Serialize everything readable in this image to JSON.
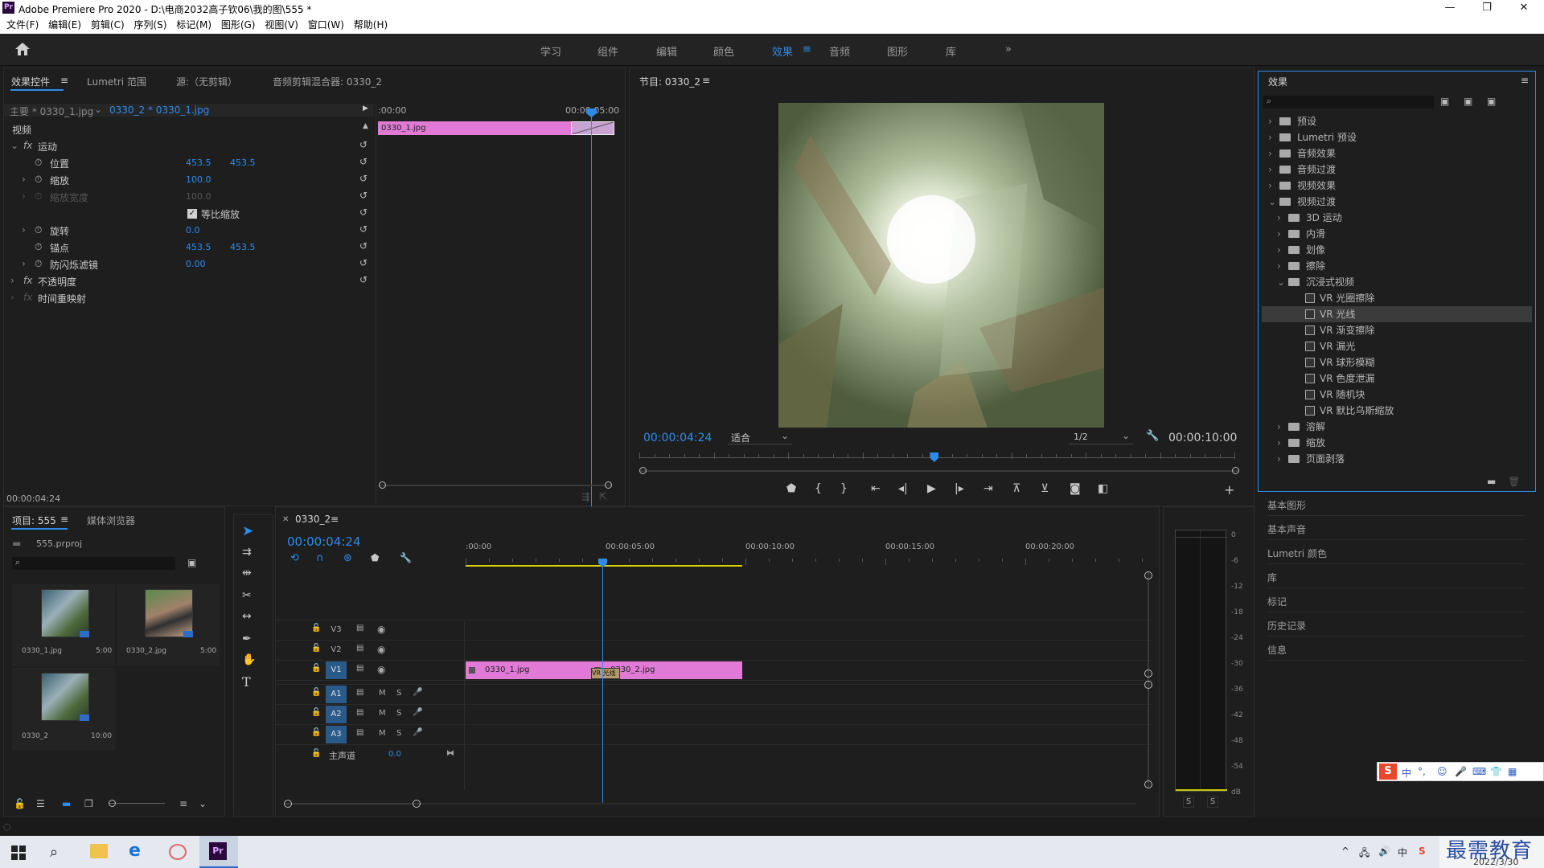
{
  "window": {
    "app_icon": "Pr",
    "title": "Adobe Premiere Pro 2020 - D:\\电商2032高子钦06\\我的图\\555 *",
    "min": "—",
    "max": "❐",
    "close": "✕"
  },
  "menu": [
    "文件(F)",
    "编辑(E)",
    "剪辑(C)",
    "序列(S)",
    "标记(M)",
    "图形(G)",
    "视图(V)",
    "窗口(W)",
    "帮助(H)"
  ],
  "workspaces": [
    "学习",
    "组件",
    "编辑",
    "颜色",
    "效果",
    "音频",
    "图形",
    "库"
  ],
  "active_workspace": "效果",
  "effect_controls": {
    "tabs": [
      "效果控件",
      "Lumetri 范围",
      "源:（无剪辑）",
      "音频剪辑混合器: 0330_2"
    ],
    "master": "主要 * 0330_1.jpg",
    "clip": "0330_2 * 0330_1.jpg",
    "ruler_start": ":00:00",
    "ruler_end": "00:00:05:00",
    "mini_clip": "0330_1.jpg",
    "section_video": "视频",
    "motion": "运动",
    "props": [
      {
        "name": "位置",
        "v1": "453.5",
        "v2": "453.5",
        "dim": false
      },
      {
        "name": "缩放",
        "v1": "100.0",
        "v2": "",
        "dim": false
      },
      {
        "name": "缩放宽度",
        "v1": "100.0",
        "v2": "",
        "dim": true
      },
      {
        "name": "等比缩放",
        "v1": "",
        "v2": "",
        "dim": false
      },
      {
        "name": "旋转",
        "v1": "0.0",
        "v2": "",
        "dim": false
      },
      {
        "name": "锚点",
        "v1": "453.5",
        "v2": "453.5",
        "dim": false
      },
      {
        "name": "防闪烁滤镜",
        "v1": "0.00",
        "v2": "",
        "dim": false
      }
    ],
    "opacity": "不透明度",
    "time_remap": "时间重映射",
    "timecode": "00:00:04:24"
  },
  "program": {
    "title": "节目: 0330_2",
    "timecode": "00:00:04:24",
    "fit": "适合",
    "quality": "1/2",
    "duration": "00:00:10:00",
    "playhead_fraction": 0.495
  },
  "effects": {
    "title": "效果",
    "search_placeholder": "",
    "tree": [
      {
        "label": "预设",
        "level": 0,
        "kind": "folder",
        "open": false
      },
      {
        "label": "Lumetri 预设",
        "level": 0,
        "kind": "folder",
        "open": false
      },
      {
        "label": "音频效果",
        "level": 0,
        "kind": "folder",
        "open": false
      },
      {
        "label": "音频过渡",
        "level": 0,
        "kind": "folder",
        "open": false
      },
      {
        "label": "视频效果",
        "level": 0,
        "kind": "folder",
        "open": false
      },
      {
        "label": "视频过渡",
        "level": 0,
        "kind": "folder",
        "open": true
      },
      {
        "label": "3D 运动",
        "level": 1,
        "kind": "folder",
        "open": false
      },
      {
        "label": "内滑",
        "level": 1,
        "kind": "folder",
        "open": false
      },
      {
        "label": "划像",
        "level": 1,
        "kind": "folder",
        "open": false
      },
      {
        "label": "擦除",
        "level": 1,
        "kind": "folder",
        "open": false
      },
      {
        "label": "沉浸式视频",
        "level": 1,
        "kind": "folder",
        "open": true
      },
      {
        "label": "VR 光圈擦除",
        "level": 2,
        "kind": "item",
        "open": false
      },
      {
        "label": "VR 光线",
        "level": 2,
        "kind": "item",
        "open": false,
        "selected": true
      },
      {
        "label": "VR 渐变擦除",
        "level": 2,
        "kind": "item",
        "open": false
      },
      {
        "label": "VR 漏光",
        "level": 2,
        "kind": "item",
        "open": false
      },
      {
        "label": "VR 球形模糊",
        "level": 2,
        "kind": "item",
        "open": false
      },
      {
        "label": "VR 色度泄漏",
        "level": 2,
        "kind": "item",
        "open": false
      },
      {
        "label": "VR 随机块",
        "level": 2,
        "kind": "item",
        "open": false
      },
      {
        "label": "VR 默比乌斯缩放",
        "level": 2,
        "kind": "item",
        "open": false
      },
      {
        "label": "溶解",
        "level": 1,
        "kind": "folder",
        "open": false
      },
      {
        "label": "缩放",
        "level": 1,
        "kind": "folder",
        "open": false
      },
      {
        "label": "页面剥落",
        "level": 1,
        "kind": "folder",
        "open": false
      }
    ],
    "collapsed_panels": [
      "基本图形",
      "基本声音",
      "Lumetri 颜色",
      "库",
      "标记",
      "历史记录",
      "信息"
    ]
  },
  "project": {
    "tabs": [
      "项目: 555",
      "媒体浏览器"
    ],
    "file": "555.prproj",
    "items": [
      {
        "name": "0330_1.jpg",
        "dur": "5:00"
      },
      {
        "name": "0330_2.jpg",
        "dur": "5:00"
      },
      {
        "name": "0330_2",
        "dur": "10:00"
      }
    ]
  },
  "timeline": {
    "tab": "0330_2",
    "timecode": "00:00:04:24",
    "ruler": [
      ":00:00",
      "00:00:05:00",
      "00:00:10:00",
      "00:00:15:00",
      "00:00:20:00"
    ],
    "video_tracks": [
      "V3",
      "V2",
      "V1"
    ],
    "audio_tracks": [
      "A1",
      "A2",
      "A3"
    ],
    "master": "主声道",
    "master_val": "0.0",
    "clip1": "0330_1.jpg",
    "clip2": "0330_2.jpg",
    "transition": "VR 光线",
    "m": "M",
    "s": "S"
  },
  "meter": {
    "ticks": [
      "0",
      "-6",
      "-12",
      "-18",
      "-24",
      "-30",
      "-36",
      "-42",
      "-48",
      "-54",
      "dB"
    ],
    "s1": "S",
    "s2": "S"
  },
  "ime": [
    "S",
    "中",
    "°,",
    "☺",
    "🎤",
    "⌨",
    "👕",
    "▦"
  ],
  "watermark": {
    "text": "最需教育",
    "date": "2022/3/30"
  },
  "tray": [
    "^",
    "🖧",
    "🔊",
    "中",
    "S"
  ]
}
